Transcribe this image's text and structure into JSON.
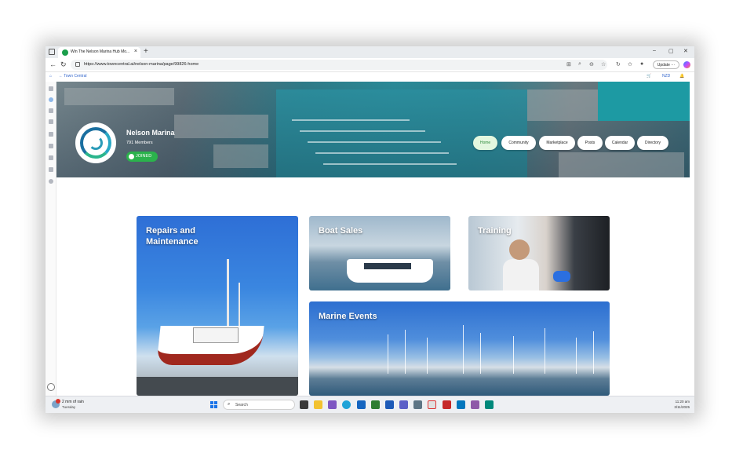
{
  "browser": {
    "tab_title": "Win The Nelson Marina Hub Mo...",
    "tab_close": "×",
    "new_tab": "+",
    "url": "https://www.towncentral.ai/nelson-marina/page/99826-home",
    "update_label": "Update",
    "window_controls": [
      "–",
      "▢",
      "✕"
    ]
  },
  "bookmarks": {
    "back_link": "← Town Central",
    "currency": "NZD"
  },
  "group": {
    "name": "Nelson Marina",
    "members": "791 Members",
    "joined_label": "JOINED",
    "nav": [
      "Home",
      "Community",
      "Marketplace",
      "Posts",
      "Calendar",
      "Directory"
    ]
  },
  "cards": {
    "repairs": "Repairs and Maintenance",
    "boat_sales": "Boat Sales",
    "training": "Training",
    "marine_events": "Marine Events"
  },
  "taskbar": {
    "weather_line1": "2 mm of rain",
    "weather_line2": "Tuesday",
    "search_placeholder": "Search",
    "time": "11:20 am",
    "date": "3/11/2025"
  },
  "colors": {
    "accent_green": "#2bb24c",
    "active_nav_text": "#2e8b3a",
    "link_blue": "#3366cc"
  }
}
